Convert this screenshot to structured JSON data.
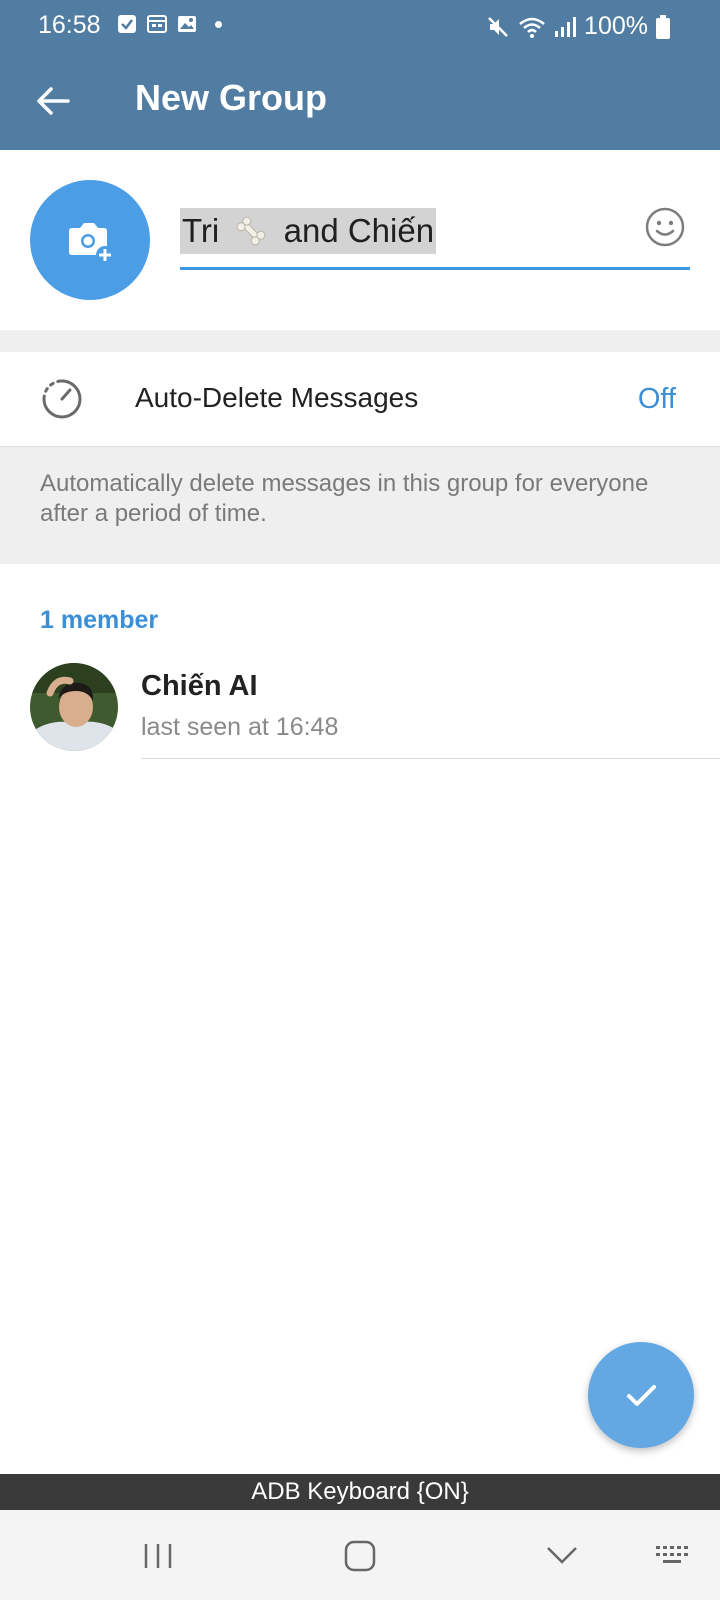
{
  "status_bar": {
    "time": "16:58",
    "battery": "100%"
  },
  "app_bar": {
    "title": "New Group"
  },
  "group_name": {
    "value_part1": "Tri",
    "value_part2": "and Chiến",
    "emoji_in_value": "bone"
  },
  "auto_delete": {
    "label": "Auto-Delete Messages",
    "value": "Off",
    "hint": "Automatically delete messages in this group for everyone after a period of time."
  },
  "members": {
    "header": "1 member",
    "items": [
      {
        "name": "Chiến AI",
        "status": "last seen at 16:48"
      }
    ]
  },
  "keyboard_banner": "ADB Keyboard {ON}",
  "colors": {
    "header": "#527da3",
    "accent": "#3b8fd6",
    "fab": "#64a8e3"
  }
}
